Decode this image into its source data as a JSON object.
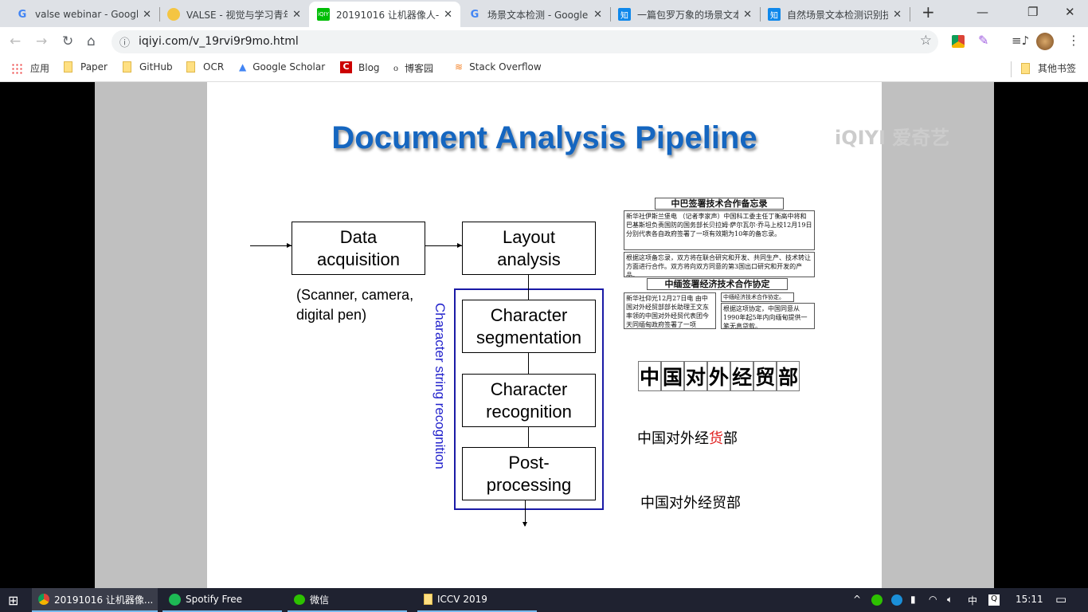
{
  "tabs": [
    {
      "title": "valse webinar - Googl",
      "icon": "google-icon",
      "active": false
    },
    {
      "title": "VALSE - 视觉与学习青年",
      "icon": "valse-icon",
      "active": false
    },
    {
      "title": "20191016 让机器像人-",
      "icon": "iqiyi-icon",
      "active": true
    },
    {
      "title": "场景文本检测 - Google",
      "icon": "google-icon",
      "active": false
    },
    {
      "title": "一篇包罗万象的场景文本",
      "icon": "zhihu-icon",
      "active": false
    },
    {
      "title": "自然场景文本检测识别技",
      "icon": "zhihu-icon",
      "active": false
    }
  ],
  "new_tab": "+",
  "address": "iqiyi.com/v_19rvi9r9mo.html",
  "bookmarks": [
    {
      "label": "应用",
      "icon": "apps-icon"
    },
    {
      "label": "Paper",
      "icon": "folder-icon"
    },
    {
      "label": "GitHub",
      "icon": "folder-icon"
    },
    {
      "label": "OCR",
      "icon": "folder-icon"
    },
    {
      "label": "Google Scholar",
      "icon": "scholar-icon"
    },
    {
      "label": "Blog",
      "icon": "blog-icon"
    },
    {
      "label": "博客园",
      "icon": "cnblogs-icon"
    },
    {
      "label": "Stack Overflow",
      "icon": "stackoverflow-icon"
    }
  ],
  "other_bookmarks": "其他书签",
  "slide": {
    "title": "Document Analysis Pipeline",
    "watermark": "iQIYI 爱奇艺",
    "box_data": "Data\nacquisition",
    "box_layout": "Layout\nanalysis",
    "box_seg": "Character\nsegmentation",
    "box_rec": "Character\nrecognition",
    "box_post": "Post-\nprocessing",
    "note": "(Scanner, camera,\ndigital pen)",
    "vertical_label": "Character string recognition",
    "news": {
      "title1": "中巴签署技术合作备忘录",
      "p1": "新华社伊斯兰堡电 （记者李家声）中国科工委主任丁衡高中将和巴基斯坦负责国防的国务部长贝拉姆·萨尔瓦尔·乔马上校12月19日分别代表各自政府签署了一项有效期为10年的备忘录。",
      "p2": "根据这项备忘录，双方将在联合研究和开发、共同生产、技术转让方面进行合作。双方将向双方同意的第3国出口研究和开发的产品。",
      "title2": "中缅签署经济技术合作协定",
      "p3": "新华社仰光12月27日电 由中国对外经贸部部长助理王文东率领的中国对外经贸代表团今天同缅甸政府签署了一项",
      "p4_label": "中缅经济技术合作协定。",
      "p4": "根据这项协定，中国同意从1990年起5年内向缅甸提供一笔无息贷款。"
    },
    "segmented": [
      "中",
      "国",
      "对",
      "外",
      "经",
      "贸",
      "部"
    ],
    "recog_pre": "中国对外经",
    "recog_err": "货",
    "recog_post": "部",
    "corrected": "中国对外经贸部",
    "error_color": "#e02020"
  },
  "taskbar": {
    "items": [
      {
        "label": "20191016 让机器像...",
        "icon": "chrome-icon"
      },
      {
        "label": "Spotify Free",
        "icon": "spotify-icon"
      },
      {
        "label": "微信",
        "icon": "wechat-icon"
      },
      {
        "label": "ICCV 2019",
        "icon": "folder-icon"
      }
    ],
    "ime": "中",
    "time": "15:11"
  }
}
